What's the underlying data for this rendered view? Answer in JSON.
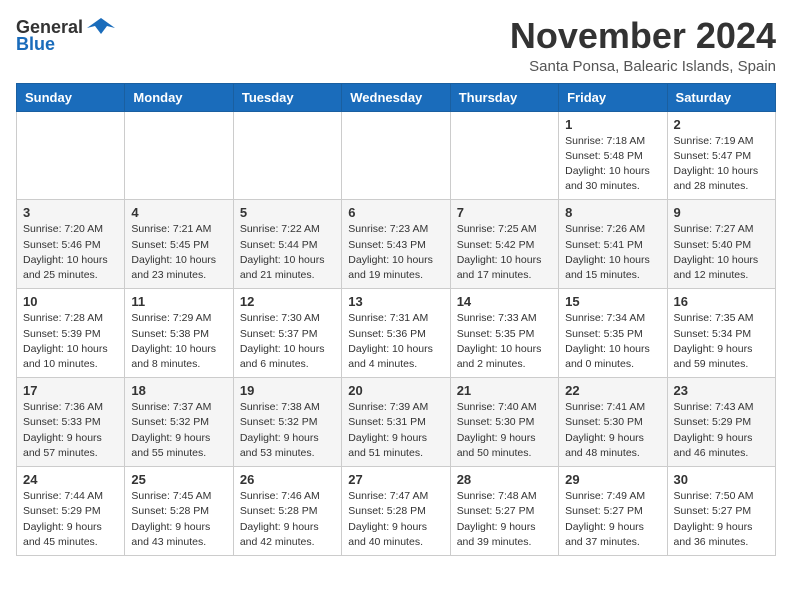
{
  "header": {
    "logo_general": "General",
    "logo_blue": "Blue",
    "title": "November 2024",
    "location": "Santa Ponsa, Balearic Islands, Spain"
  },
  "calendar": {
    "days_of_week": [
      "Sunday",
      "Monday",
      "Tuesday",
      "Wednesday",
      "Thursday",
      "Friday",
      "Saturday"
    ],
    "weeks": [
      [
        {
          "day": "",
          "info": ""
        },
        {
          "day": "",
          "info": ""
        },
        {
          "day": "",
          "info": ""
        },
        {
          "day": "",
          "info": ""
        },
        {
          "day": "",
          "info": ""
        },
        {
          "day": "1",
          "info": "Sunrise: 7:18 AM\nSunset: 5:48 PM\nDaylight: 10 hours\nand 30 minutes."
        },
        {
          "day": "2",
          "info": "Sunrise: 7:19 AM\nSunset: 5:47 PM\nDaylight: 10 hours\nand 28 minutes."
        }
      ],
      [
        {
          "day": "3",
          "info": "Sunrise: 7:20 AM\nSunset: 5:46 PM\nDaylight: 10 hours\nand 25 minutes."
        },
        {
          "day": "4",
          "info": "Sunrise: 7:21 AM\nSunset: 5:45 PM\nDaylight: 10 hours\nand 23 minutes."
        },
        {
          "day": "5",
          "info": "Sunrise: 7:22 AM\nSunset: 5:44 PM\nDaylight: 10 hours\nand 21 minutes."
        },
        {
          "day": "6",
          "info": "Sunrise: 7:23 AM\nSunset: 5:43 PM\nDaylight: 10 hours\nand 19 minutes."
        },
        {
          "day": "7",
          "info": "Sunrise: 7:25 AM\nSunset: 5:42 PM\nDaylight: 10 hours\nand 17 minutes."
        },
        {
          "day": "8",
          "info": "Sunrise: 7:26 AM\nSunset: 5:41 PM\nDaylight: 10 hours\nand 15 minutes."
        },
        {
          "day": "9",
          "info": "Sunrise: 7:27 AM\nSunset: 5:40 PM\nDaylight: 10 hours\nand 12 minutes."
        }
      ],
      [
        {
          "day": "10",
          "info": "Sunrise: 7:28 AM\nSunset: 5:39 PM\nDaylight: 10 hours\nand 10 minutes."
        },
        {
          "day": "11",
          "info": "Sunrise: 7:29 AM\nSunset: 5:38 PM\nDaylight: 10 hours\nand 8 minutes."
        },
        {
          "day": "12",
          "info": "Sunrise: 7:30 AM\nSunset: 5:37 PM\nDaylight: 10 hours\nand 6 minutes."
        },
        {
          "day": "13",
          "info": "Sunrise: 7:31 AM\nSunset: 5:36 PM\nDaylight: 10 hours\nand 4 minutes."
        },
        {
          "day": "14",
          "info": "Sunrise: 7:33 AM\nSunset: 5:35 PM\nDaylight: 10 hours\nand 2 minutes."
        },
        {
          "day": "15",
          "info": "Sunrise: 7:34 AM\nSunset: 5:35 PM\nDaylight: 10 hours\nand 0 minutes."
        },
        {
          "day": "16",
          "info": "Sunrise: 7:35 AM\nSunset: 5:34 PM\nDaylight: 9 hours\nand 59 minutes."
        }
      ],
      [
        {
          "day": "17",
          "info": "Sunrise: 7:36 AM\nSunset: 5:33 PM\nDaylight: 9 hours\nand 57 minutes."
        },
        {
          "day": "18",
          "info": "Sunrise: 7:37 AM\nSunset: 5:32 PM\nDaylight: 9 hours\nand 55 minutes."
        },
        {
          "day": "19",
          "info": "Sunrise: 7:38 AM\nSunset: 5:32 PM\nDaylight: 9 hours\nand 53 minutes."
        },
        {
          "day": "20",
          "info": "Sunrise: 7:39 AM\nSunset: 5:31 PM\nDaylight: 9 hours\nand 51 minutes."
        },
        {
          "day": "21",
          "info": "Sunrise: 7:40 AM\nSunset: 5:30 PM\nDaylight: 9 hours\nand 50 minutes."
        },
        {
          "day": "22",
          "info": "Sunrise: 7:41 AM\nSunset: 5:30 PM\nDaylight: 9 hours\nand 48 minutes."
        },
        {
          "day": "23",
          "info": "Sunrise: 7:43 AM\nSunset: 5:29 PM\nDaylight: 9 hours\nand 46 minutes."
        }
      ],
      [
        {
          "day": "24",
          "info": "Sunrise: 7:44 AM\nSunset: 5:29 PM\nDaylight: 9 hours\nand 45 minutes."
        },
        {
          "day": "25",
          "info": "Sunrise: 7:45 AM\nSunset: 5:28 PM\nDaylight: 9 hours\nand 43 minutes."
        },
        {
          "day": "26",
          "info": "Sunrise: 7:46 AM\nSunset: 5:28 PM\nDaylight: 9 hours\nand 42 minutes."
        },
        {
          "day": "27",
          "info": "Sunrise: 7:47 AM\nSunset: 5:28 PM\nDaylight: 9 hours\nand 40 minutes."
        },
        {
          "day": "28",
          "info": "Sunrise: 7:48 AM\nSunset: 5:27 PM\nDaylight: 9 hours\nand 39 minutes."
        },
        {
          "day": "29",
          "info": "Sunrise: 7:49 AM\nSunset: 5:27 PM\nDaylight: 9 hours\nand 37 minutes."
        },
        {
          "day": "30",
          "info": "Sunrise: 7:50 AM\nSunset: 5:27 PM\nDaylight: 9 hours\nand 36 minutes."
        }
      ]
    ]
  }
}
